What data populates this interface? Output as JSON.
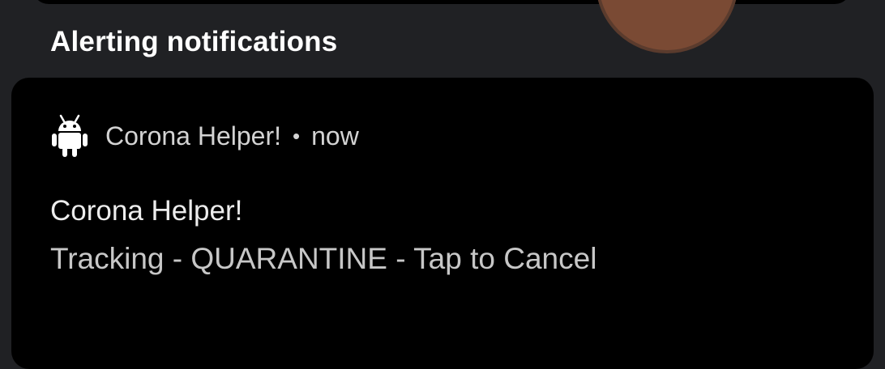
{
  "section": {
    "title": "Alerting notifications"
  },
  "notification": {
    "app_icon": "android-icon",
    "app_name": "Corona Helper!",
    "separator": "•",
    "time": "now",
    "title": "Corona Helper!",
    "text": "Tracking - QUARANTINE - Tap to Cancel"
  },
  "colors": {
    "background": "#202124",
    "card": "#000000",
    "primary_text": "#ffffff",
    "secondary_text": "#c7c7c7"
  }
}
